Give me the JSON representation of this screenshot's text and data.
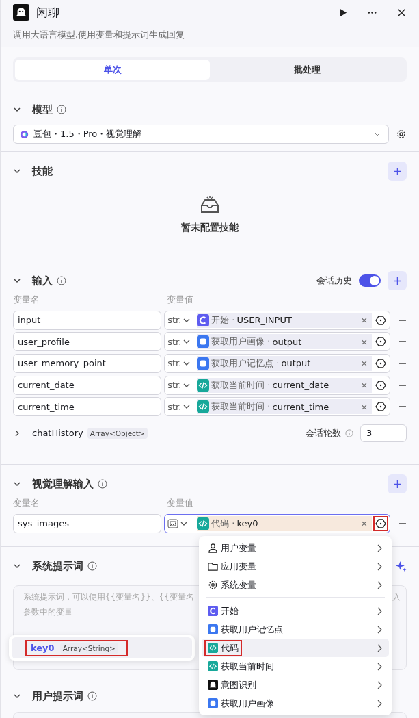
{
  "header": {
    "title": "闲聊",
    "description": "调用大语言模型,使用变量和提示词生成回复"
  },
  "tabs": [
    {
      "label": "单次",
      "selected": true
    },
    {
      "label": "批处理",
      "selected": false
    }
  ],
  "model": {
    "title": "模型",
    "value": "豆包・1.5・Pro・视觉理解"
  },
  "skills": {
    "title": "技能",
    "empty_text": "暂未配置技能"
  },
  "ref_separator": "·",
  "inputs": {
    "title": "输入",
    "history_label": "会话历史",
    "history_on": true,
    "name_header": "变量名",
    "value_header": "变量值",
    "rows": [
      {
        "name": "input",
        "type": "str.",
        "kind": "start",
        "node": "开始",
        "field": "USER_INPUT",
        "clear": "×"
      },
      {
        "name": "user_profile",
        "type": "str.",
        "kind": "plugin",
        "node": "获取用户画像",
        "field": "output",
        "clear": "×"
      },
      {
        "name": "user_memory_point",
        "type": "str.",
        "kind": "plugin",
        "node": "获取用户记忆点",
        "field": "output",
        "clear": "×"
      },
      {
        "name": "current_date",
        "type": "str.",
        "kind": "code",
        "node": "获取当前时间",
        "field": "current_date",
        "clear": "×"
      },
      {
        "name": "current_time",
        "type": "str.",
        "kind": "code",
        "node": "获取当前时间",
        "field": "current_time",
        "clear": "×"
      }
    ],
    "chat_history": {
      "name": "chatHistory",
      "type": "Array<Object>",
      "expanded": false
    },
    "rounds_label": "会话轮数",
    "rounds": "3"
  },
  "vision": {
    "title": "视觉理解输入",
    "name_header": "变量名",
    "value_header": "变量值",
    "rows": [
      {
        "name": "sys_images",
        "type": {
          "kind": "image"
        },
        "kind": "code",
        "node": "代码",
        "field": "key0",
        "clear": "×",
        "focused": true,
        "highlighted": true
      }
    ]
  },
  "system_prompt": {
    "title": "系统提示词",
    "placeholder_parts": [
      "系统提示词，可以使用{{变量名}}、{{变量名",
      "入",
      "参数中的变量"
    ]
  },
  "menu": {
    "groups": [
      [
        {
          "label": "用户变量",
          "kind": "user",
          "selected": false,
          "highlighted": false
        },
        {
          "label": "应用变量",
          "kind": "folder",
          "selected": false,
          "highlighted": false
        },
        {
          "label": "系统变量",
          "kind": "gear",
          "selected": false,
          "highlighted": false
        }
      ],
      [
        {
          "label": "开始",
          "kind": "start",
          "selected": false,
          "highlighted": false
        },
        {
          "label": "获取用户记忆点",
          "kind": "plugin",
          "selected": false,
          "highlighted": false
        },
        {
          "label": "代码",
          "kind": "code",
          "selected": true,
          "highlighted": true
        },
        {
          "label": "获取当前时间",
          "kind": "code",
          "selected": false,
          "highlighted": false
        },
        {
          "label": "意图识别",
          "kind": "intent",
          "selected": false,
          "highlighted": false
        },
        {
          "label": "获取用户画像",
          "kind": "plugin",
          "selected": false,
          "highlighted": false
        }
      ]
    ]
  },
  "submenu": {
    "items": [
      {
        "name": "key0",
        "type": "Array<String>",
        "highlighted": true
      }
    ]
  },
  "user_prompt": {
    "title": "用户提示词"
  }
}
